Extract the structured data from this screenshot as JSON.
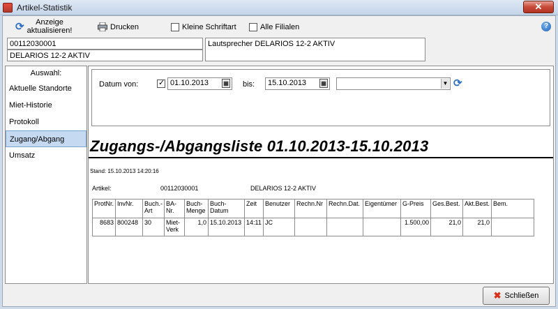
{
  "window": {
    "title": "Artikel-Statistik",
    "close_glyph": "✕"
  },
  "toolbar": {
    "refresh_label_1": "Anzeige",
    "refresh_label_2": "aktualisieren!",
    "print_label": "Drucken",
    "small_font_label": "Kleine Schriftart",
    "small_font_checked": false,
    "all_branches_label": "Alle Filialen",
    "all_branches_checked": false,
    "help_glyph": "?"
  },
  "article": {
    "number": "00112030001",
    "name": "DELARIOS 12-2 AKTIV",
    "description": "Lautsprecher DELARIOS 12-2 AKTIV"
  },
  "nav": {
    "title": "Auswahl:",
    "items": [
      {
        "label": "Aktuelle Standorte",
        "active": false
      },
      {
        "label": "Miet-Historie",
        "active": false
      },
      {
        "label": "Protokoll",
        "active": false
      },
      {
        "label": "Zugang/Abgang",
        "active": true
      },
      {
        "label": "Umsatz",
        "active": false
      }
    ]
  },
  "filter": {
    "date_from_label": "Datum von:",
    "date_from_checked": true,
    "date_from": "01.10.2013",
    "date_to_label": "bis:",
    "date_to": "15.10.2013",
    "select_value": ""
  },
  "report": {
    "title": "Zugangs-/Abgangsliste 01.10.2013-15.10.2013",
    "stand": "Stand: 15.10.2013 14:20:16",
    "article_label": "Artikel:",
    "article_number": "00112030001",
    "article_name": "DELARIOS 12-2 AKTIV",
    "columns": [
      "ProtNr.",
      "InvNr.",
      "Buch.-\nArt",
      "BA-\nNr.",
      "Buch-\nMenge",
      "Buch-\nDatum",
      "Zeit",
      "Benutzer",
      "Rechn.Nr",
      "Rechn.Dat.",
      "Eigentümer",
      "G-Preis",
      "Ges.Best.",
      "Akt.Best.",
      "Bem."
    ],
    "rows": [
      [
        "8683",
        "800248",
        "30",
        "Miet-\nVerk",
        "1,0",
        "15.10.2013",
        "14:11",
        "JC",
        "",
        "",
        "",
        "1.500,00",
        "21,0",
        "21,0",
        ""
      ]
    ]
  },
  "footer": {
    "close_label": "Schließen"
  }
}
